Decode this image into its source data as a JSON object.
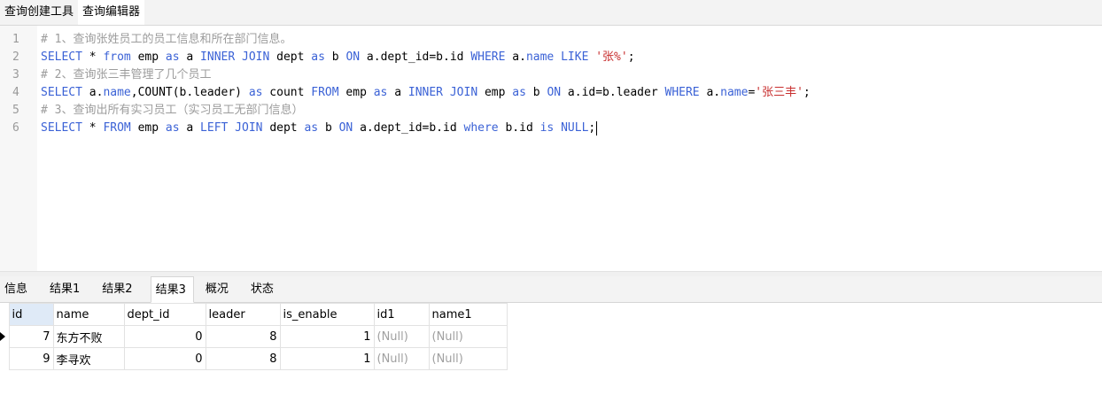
{
  "top_tabs": [
    {
      "label": "查询创建工具",
      "active": false
    },
    {
      "label": "查询编辑器",
      "active": true
    }
  ],
  "editor": {
    "lines": [
      {
        "num": "1",
        "tokens": [
          {
            "t": "cm",
            "v": "# 1、查询张姓员工的员工信息和所在部门信息。"
          }
        ]
      },
      {
        "num": "2",
        "tokens": [
          {
            "t": "kw",
            "v": "SELECT"
          },
          {
            "t": "tx",
            "v": " * "
          },
          {
            "t": "kw",
            "v": "from"
          },
          {
            "t": "tx",
            "v": " emp "
          },
          {
            "t": "kw",
            "v": "as"
          },
          {
            "t": "tx",
            "v": " a "
          },
          {
            "t": "kw",
            "v": "INNER JOIN"
          },
          {
            "t": "tx",
            "v": " dept "
          },
          {
            "t": "kw",
            "v": "as"
          },
          {
            "t": "tx",
            "v": " b "
          },
          {
            "t": "kw",
            "v": "ON"
          },
          {
            "t": "tx",
            "v": " a.dept_id=b.id "
          },
          {
            "t": "kw",
            "v": "WHERE"
          },
          {
            "t": "tx",
            "v": " a."
          },
          {
            "t": "kw",
            "v": "name"
          },
          {
            "t": "tx",
            "v": " "
          },
          {
            "t": "kw",
            "v": "LIKE"
          },
          {
            "t": "tx",
            "v": " "
          },
          {
            "t": "str",
            "v": "'张%'"
          },
          {
            "t": "tx",
            "v": ";"
          }
        ]
      },
      {
        "num": "3",
        "tokens": [
          {
            "t": "cm",
            "v": "# 2、查询张三丰管理了几个员工"
          }
        ]
      },
      {
        "num": "4",
        "tokens": [
          {
            "t": "kw",
            "v": "SELECT"
          },
          {
            "t": "tx",
            "v": " a."
          },
          {
            "t": "kw",
            "v": "name"
          },
          {
            "t": "tx",
            "v": ",COUNT(b.leader) "
          },
          {
            "t": "kw",
            "v": "as"
          },
          {
            "t": "tx",
            "v": " count "
          },
          {
            "t": "kw",
            "v": "FROM"
          },
          {
            "t": "tx",
            "v": " emp "
          },
          {
            "t": "kw",
            "v": "as"
          },
          {
            "t": "tx",
            "v": " a "
          },
          {
            "t": "kw",
            "v": "INNER JOIN"
          },
          {
            "t": "tx",
            "v": " emp "
          },
          {
            "t": "kw",
            "v": "as"
          },
          {
            "t": "tx",
            "v": " b "
          },
          {
            "t": "kw",
            "v": "ON"
          },
          {
            "t": "tx",
            "v": " a.id=b.leader "
          },
          {
            "t": "kw",
            "v": "WHERE"
          },
          {
            "t": "tx",
            "v": " a."
          },
          {
            "t": "kw",
            "v": "name"
          },
          {
            "t": "tx",
            "v": "="
          },
          {
            "t": "str",
            "v": "'张三丰'"
          },
          {
            "t": "tx",
            "v": ";"
          }
        ]
      },
      {
        "num": "5",
        "tokens": [
          {
            "t": "cm",
            "v": "# 3、查询出所有实习员工（实习员工无部门信息）"
          }
        ]
      },
      {
        "num": "6",
        "tokens": [
          {
            "t": "kw",
            "v": "SELECT"
          },
          {
            "t": "tx",
            "v": " * "
          },
          {
            "t": "kw",
            "v": "FROM"
          },
          {
            "t": "tx",
            "v": " emp "
          },
          {
            "t": "kw",
            "v": "as"
          },
          {
            "t": "tx",
            "v": " a "
          },
          {
            "t": "kw",
            "v": "LEFT JOIN"
          },
          {
            "t": "tx",
            "v": " dept "
          },
          {
            "t": "kw",
            "v": "as"
          },
          {
            "t": "tx",
            "v": " b "
          },
          {
            "t": "kw",
            "v": "ON"
          },
          {
            "t": "tx",
            "v": " a.dept_id=b.id "
          },
          {
            "t": "kw",
            "v": "where"
          },
          {
            "t": "tx",
            "v": " b.id "
          },
          {
            "t": "kw",
            "v": "is"
          },
          {
            "t": "tx",
            "v": " "
          },
          {
            "t": "kw",
            "v": "NULL"
          },
          {
            "t": "tx",
            "v": ";"
          }
        ]
      }
    ]
  },
  "result_tabs": [
    {
      "label": "信息",
      "active": false
    },
    {
      "label": "结果1",
      "active": false
    },
    {
      "label": "结果2",
      "active": false
    },
    {
      "label": "结果3",
      "active": true
    },
    {
      "label": "概况",
      "active": false
    },
    {
      "label": "状态",
      "active": false
    }
  ],
  "grid": {
    "columns": [
      "id",
      "name",
      "dept_id",
      "leader",
      "is_enable",
      "id1",
      "name1"
    ],
    "rows": [
      {
        "current": true,
        "cells": [
          "7",
          "东方不败",
          "0",
          "8",
          "1",
          "(Null)",
          "(Null)"
        ]
      },
      {
        "current": false,
        "cells": [
          "9",
          "李寻欢",
          "0",
          "8",
          "1",
          "(Null)",
          "(Null)"
        ]
      }
    ]
  },
  "colors": {
    "keyword": "#3b62d6",
    "comment": "#9c9c9c",
    "string": "#c82e2e",
    "null_text": "#a0a0a0",
    "header_selected": "#dfeaf7"
  }
}
